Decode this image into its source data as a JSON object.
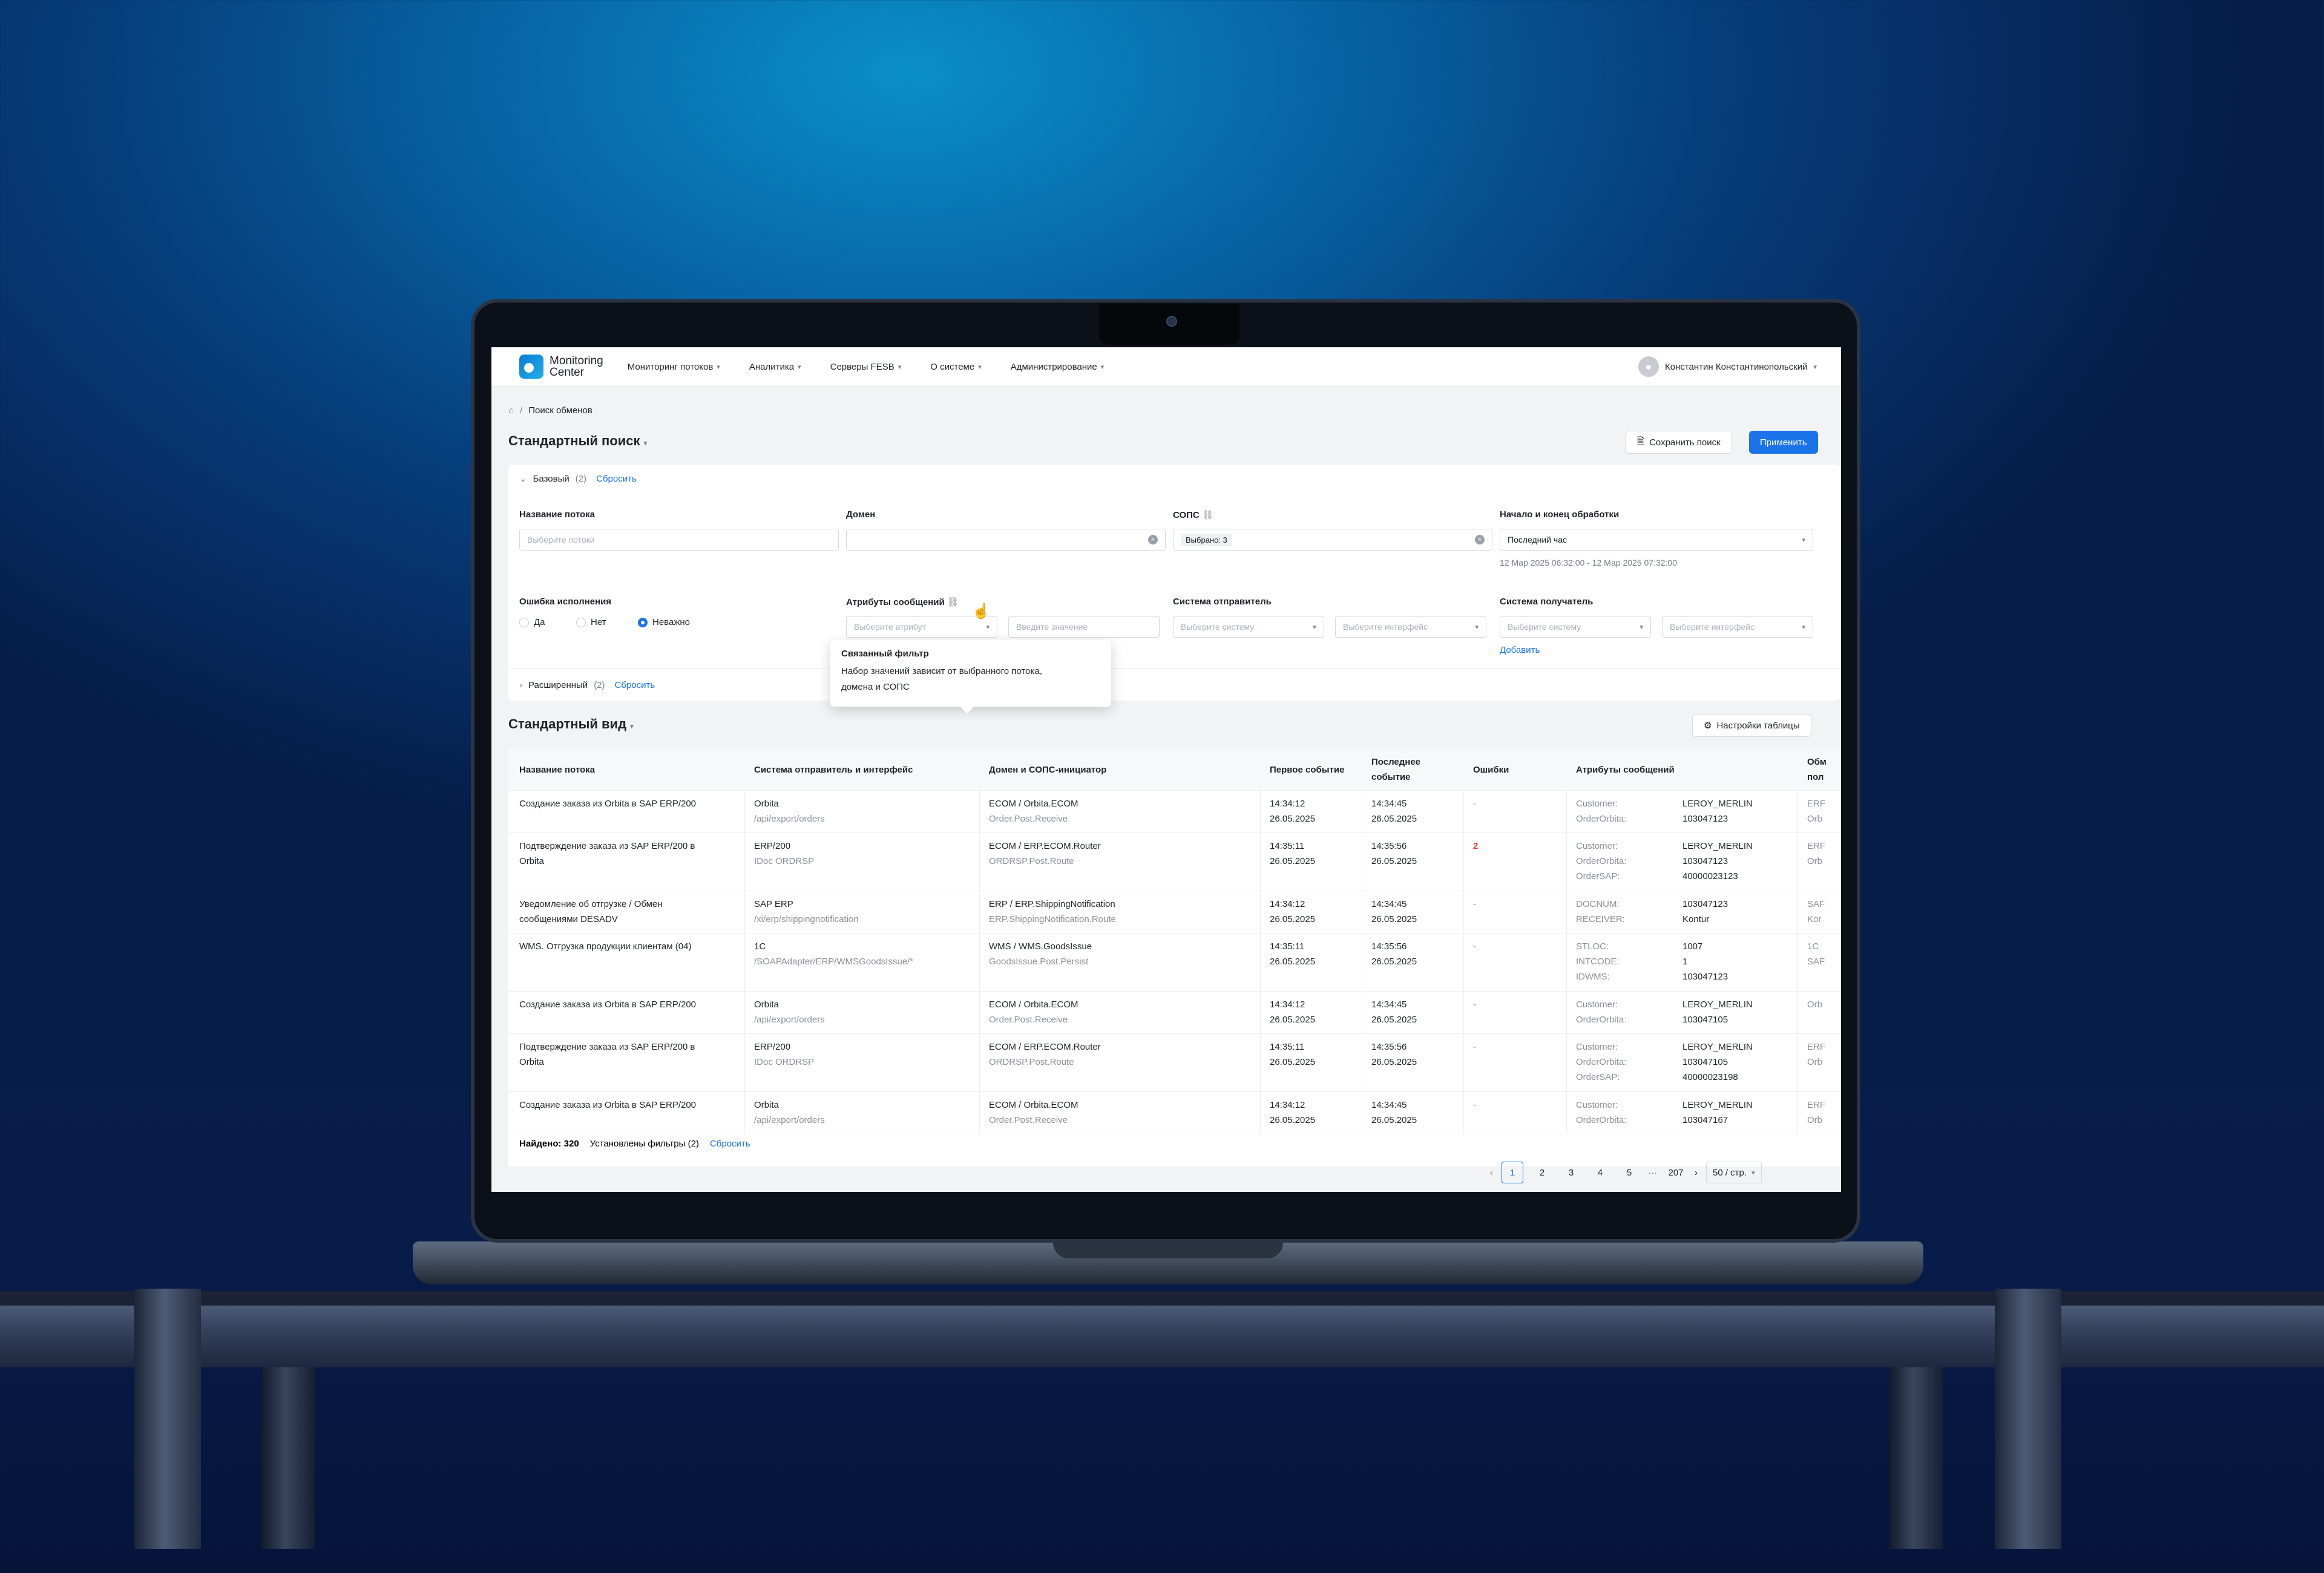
{
  "app": {
    "logo_line1": "Monitoring",
    "logo_line2": "Center"
  },
  "nav": [
    {
      "label": "Мониторинг потоков"
    },
    {
      "label": "Аналитика"
    },
    {
      "label": "Серверы FESB"
    },
    {
      "label": "О системе"
    },
    {
      "label": "Администрирование"
    }
  ],
  "user": {
    "name": "Константин Константинопольский"
  },
  "breadcrumb": {
    "current": "Поиск обменов"
  },
  "page": {
    "title": "Стандартный поиск",
    "save_label": "Сохранить поиск",
    "apply_label": "Применить"
  },
  "basic": {
    "title": "Базовый",
    "count": "(2)",
    "reset": "Сбросить",
    "flow_label": "Название потока",
    "flow_placeholder": "Выберите потоки",
    "domain_label": "Домен",
    "sops_label": "СОПС",
    "sops_value": "Выбрано: 3",
    "period_label": "Начало и конец обработки",
    "period_value": "Последний час",
    "period_range": "12 Мар 2025 06:32:00 - 12 Мар 2025 07:32:00",
    "error_label": "Ошибка исполнения",
    "error_options": [
      "Да",
      "Нет",
      "Неважно"
    ],
    "error_selected": "Неважно",
    "attrs_label": "Атрибуты сообщений",
    "attr_placeholder": "Выберите атрибут",
    "value_placeholder": "Введите значение",
    "sender_label": "Система отправитель",
    "system_placeholder": "Выберите систему",
    "iface_placeholder": "Выберите интерфейс",
    "receiver_label": "Система получатель",
    "add": "Добавить"
  },
  "tooltip": {
    "title": "Связанный фильтр",
    "body_line1": "Набор значений зависит от выбранного потока,",
    "body_line2": "домена и СОПС"
  },
  "advanced": {
    "title": "Расширенный",
    "count": "(2)",
    "reset": "Сбросить"
  },
  "view": {
    "title": "Стандартный вид",
    "settings_label": "Настройки таблицы"
  },
  "table": {
    "headers": [
      "Название потока",
      "Система отправитель и интерфейс",
      "Домен и СОПС-инициатор",
      "Первое событие",
      "Последнее событие",
      "Ошибки",
      "Атрибуты сообщений",
      "Обм пол"
    ],
    "rows": [
      {
        "name1": "Создание заказа из Orbita в SAP ERP/200",
        "name2": "",
        "sys": "Orbita",
        "iface": "/api/export/orders",
        "dom": "ECOM / Orbita.ECOM",
        "sops": "Order.Post.Receive",
        "t1": "14:34:12",
        "d1": "26.05.2025",
        "t2": "14:34:45",
        "d2": "26.05.2025",
        "err": "-",
        "ak": [
          "Customer:",
          "OrderOrbita:"
        ],
        "av": [
          "LEROY_MERLIN",
          "103047123"
        ],
        "x1": "ERF",
        "x2": "Orb"
      },
      {
        "name1": "Подтверждение заказа из SAP ERP/200 в",
        "name2": "Orbita",
        "sys": "ERP/200",
        "iface": "IDoc ORDRSP",
        "dom": "ECOM / ERP.ECOM.Router",
        "sops": "ORDRSP.Post.Route",
        "t1": "14:35:11",
        "d1": "26.05.2025",
        "t2": "14:35:56",
        "d2": "26.05.2025",
        "err": "2",
        "ak": [
          "Customer:",
          "OrderOrbita:",
          "OrderSAP:"
        ],
        "av": [
          "LEROY_MERLIN",
          "103047123",
          "40000023123"
        ],
        "x1": "ERF",
        "x2": "Orb"
      },
      {
        "name1": "Уведомление об отгрузке / Обмен",
        "name2": "сообщениями DESADV",
        "sys": "SAP ERP",
        "iface": "/xi/erp/shippingnotification",
        "dom": "ERP / ERP.ShippingNotification",
        "sops": "ERP.ShippingNotification.Route",
        "t1": "14:34:12",
        "d1": "26.05.2025",
        "t2": "14:34:45",
        "d2": "26.05.2025",
        "err": "-",
        "ak": [
          "DOCNUM:",
          "RECEIVER:"
        ],
        "av": [
          "103047123",
          "Kontur"
        ],
        "x1": "SAF",
        "x2": "Kor"
      },
      {
        "name1": "WMS. Отгрузка продукции клиентам (04)",
        "name2": "",
        "sys": "1C",
        "iface": "/SOAPAdapter/ERP/WMSGoodsIssue/*",
        "dom": "WMS / WMS.GoodsIssue",
        "sops": "GoodsIssue.Post.Persist",
        "t1": "14:35:11",
        "d1": "26.05.2025",
        "t2": "14:35:56",
        "d2": "26.05.2025",
        "err": "-",
        "ak": [
          "STLOC:",
          "INTCODE:",
          "IDWMS:"
        ],
        "av": [
          "1007",
          "1",
          "103047123"
        ],
        "x1": "1C",
        "x2": "SAF"
      },
      {
        "name1": "Создание заказа из Orbita в SAP ERP/200",
        "name2": "",
        "sys": "Orbita",
        "iface": "/api/export/orders",
        "dom": "ECOM / Orbita.ECOM",
        "sops": "Order.Post.Receive",
        "t1": "14:34:12",
        "d1": "26.05.2025",
        "t2": "14:34:45",
        "d2": "26.05.2025",
        "err": "-",
        "ak": [
          "Customer:",
          "OrderOrbita:"
        ],
        "av": [
          "LEROY_MERLIN",
          "103047105"
        ],
        "x1": "Orb",
        "x2": ""
      },
      {
        "name1": "Подтверждение заказа из SAP ERP/200 в",
        "name2": "Orbita",
        "sys": "ERP/200",
        "iface": "IDoc ORDRSP",
        "dom": "ECOM / ERP.ECOM.Router",
        "sops": "ORDRSP.Post.Route",
        "t1": "14:35:11",
        "d1": "26.05.2025",
        "t2": "14:35:56",
        "d2": "26.05.2025",
        "err": "-",
        "ak": [
          "Customer:",
          "OrderOrbita:",
          "OrderSAP:"
        ],
        "av": [
          "LEROY_MERLIN",
          "103047105",
          "40000023198"
        ],
        "x1": "ERF",
        "x2": "Orb"
      },
      {
        "name1": "Создание заказа из Orbita в SAP ERP/200",
        "name2": "",
        "sys": "Orbita",
        "iface": "/api/export/orders",
        "dom": "ECOM / Orbita.ECOM",
        "sops": "Order.Post.Receive",
        "t1": "14:34:12",
        "d1": "26.05.2025",
        "t2": "14:34:45",
        "d2": "26.05.2025",
        "err": "-",
        "ak": [
          "Customer:",
          "OrderOrbita:"
        ],
        "av": [
          "LEROY_MERLIN",
          "103047167"
        ],
        "x1": "ERF",
        "x2": "Orb"
      }
    ]
  },
  "footer": {
    "found": "Найдено: 320",
    "filters": "Установлены фильтры (2)",
    "reset": "Сбросить"
  },
  "pagination": {
    "pages": [
      "1",
      "2",
      "3",
      "4",
      "5"
    ],
    "ellipsis": "···",
    "last": "207",
    "per_page": "50 / стр.",
    "current": "1"
  }
}
